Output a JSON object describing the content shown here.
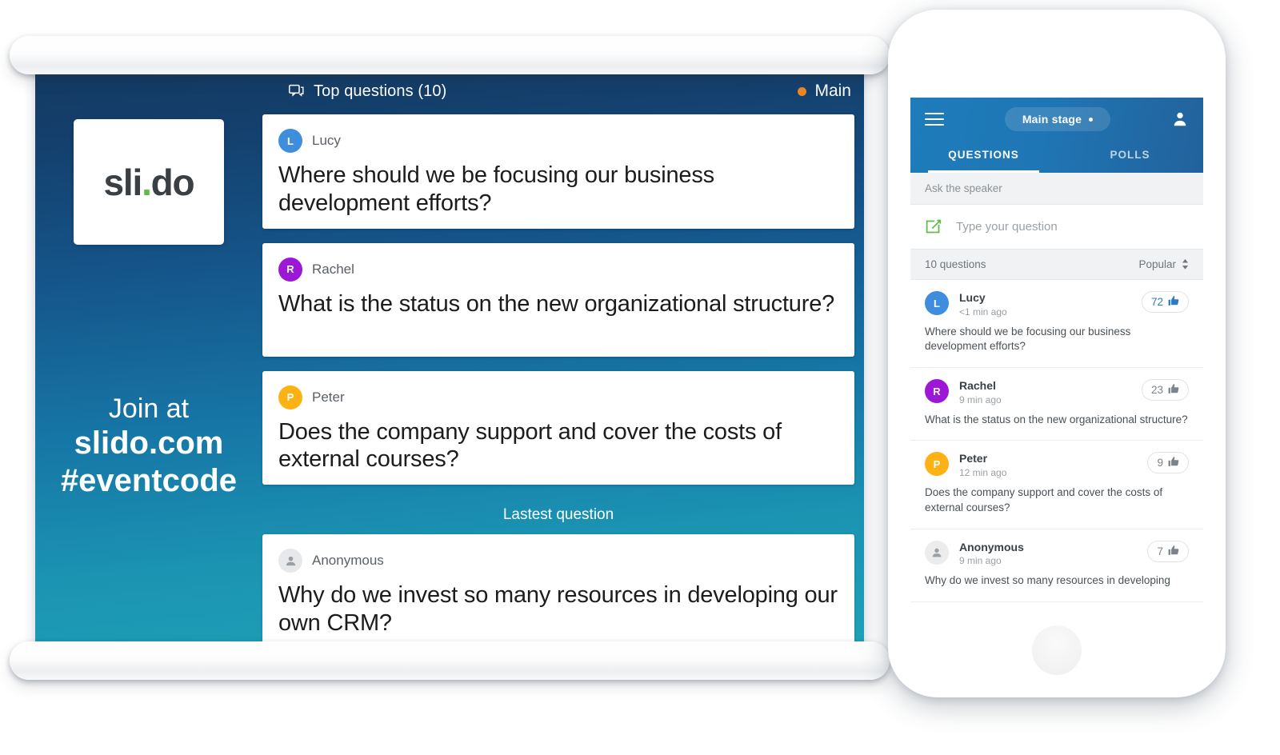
{
  "presentation": {
    "header": {
      "icon": "speech-bubble-icon",
      "title": "Top questions (10)",
      "status_dot_color": "#ef8722",
      "status_label": "Main"
    },
    "logo": {
      "text_before": "sli",
      "dot": ".",
      "text_after": "do",
      "dot_color": "#5fbb46"
    },
    "join": {
      "line1": "Join at",
      "line2": "slido.com",
      "line3": "#eventcode"
    },
    "latest_divider": "Lastest question",
    "top_questions": [
      {
        "initial": "L",
        "author": "Lucy",
        "avatar_color": "#3f8ede",
        "text": "Where should we be focusing our business development efforts?"
      },
      {
        "initial": "R",
        "author": "Rachel",
        "avatar_color": "#9c17d6",
        "text": "What is the status on the new organizational structure?"
      },
      {
        "initial": "P",
        "author": "Peter",
        "avatar_color": "#fcb215",
        "text": "Does the company support and cover the costs of external courses?"
      }
    ],
    "latest_question": {
      "initial": "",
      "author": "Anonymous",
      "avatar_color": "#e7e8ea",
      "text": "Why do we invest so many resources in developing our own CRM?"
    }
  },
  "phone": {
    "topbar": {
      "menu_icon": "hamburger-menu-icon",
      "stage_label": "Main stage",
      "profile_icon": "person-icon"
    },
    "tabs": [
      {
        "label": "QUESTIONS",
        "active": true
      },
      {
        "label": "POLLS",
        "active": false
      }
    ],
    "ask_section_label": "Ask the speaker",
    "compose": {
      "icon": "compose-pencil-icon",
      "placeholder": "Type your question",
      "value": ""
    },
    "list_header": {
      "count_label": "10 questions",
      "sort_label": "Popular",
      "sort_icon": "sort-updown-icon"
    },
    "questions": [
      {
        "initial": "L",
        "author": "Lucy",
        "avatar_color": "#3f8ede",
        "time": "<1 min ago",
        "votes": "72",
        "vote_icon": "thumbs-up-icon",
        "voted": true,
        "text": "Where should we be focusing our business development efforts?"
      },
      {
        "initial": "R",
        "author": "Rachel",
        "avatar_color": "#9c17d6",
        "time": "9 min ago",
        "votes": "23",
        "vote_icon": "thumbs-up-icon",
        "voted": false,
        "text": "What is the status on the new organizational structure?"
      },
      {
        "initial": "P",
        "author": "Peter",
        "avatar_color": "#fcb215",
        "time": "12 min ago",
        "votes": "9",
        "vote_icon": "thumbs-up-icon",
        "voted": false,
        "text": "Does the company support and cover the costs of external courses?"
      },
      {
        "initial": "",
        "author": "Anonymous",
        "avatar_color": "#ececec",
        "time": "9 min ago",
        "votes": "7",
        "vote_icon": "thumbs-up-icon",
        "voted": false,
        "text": "Why do we invest so many resources in developing"
      }
    ]
  },
  "colors": {
    "brand_blue": "#1f76b4",
    "canvas_top": "#133962",
    "canvas_bottom": "#1fa3b8",
    "accent_green": "#5fbb46",
    "accent_orange": "#ef8722"
  }
}
